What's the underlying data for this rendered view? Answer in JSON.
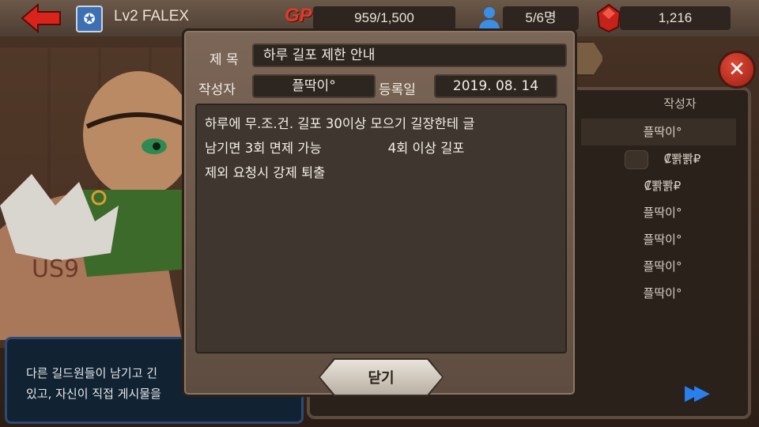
{
  "hud": {
    "guild_name": "Lv2 FALEX",
    "gp_label": "GP",
    "gp_value": "959/1,500",
    "members": "5/6명",
    "gems": "1,216",
    "back_icon": "back-arrow-icon",
    "guild_emblem_icon": "guild-emblem-icon",
    "person_icon": "person-icon",
    "gem_icon": "ruby-gem-icon"
  },
  "background": {
    "list_header": "작성자",
    "list_rows": [
      "플딱이°",
      "₡뽥뽥₽",
      "₡뽥뽥₽",
      "플딱이°",
      "플딱이°",
      "플딱이°",
      "플딱이°"
    ],
    "tip_lines": [
      "다른 길드원들이 남기고 긴",
      "있고, 자신이 직접 게시물을"
    ]
  },
  "notice": {
    "title_label": "제 목",
    "title_value": "하루 길포 제한 안내",
    "author_label": "작성자",
    "author_value": "플딱이°",
    "date_label": "등록일",
    "date_value": "2019. 08. 14",
    "content_lines": [
      "하루에 무.조.건. 길포 30이상 모으기 길장한테 글",
      "남기면 3회 면제 가능                4회 이상 길포",
      "제외 요청시 강제 퇴출"
    ],
    "close_label": "닫기"
  },
  "colors": {
    "accent_red": "#e13a28",
    "modal_bg": "#6d5a4c",
    "field_bg": "#2c2520",
    "gem_red": "#c4221a",
    "ff_blue": "#2a7ff0"
  }
}
